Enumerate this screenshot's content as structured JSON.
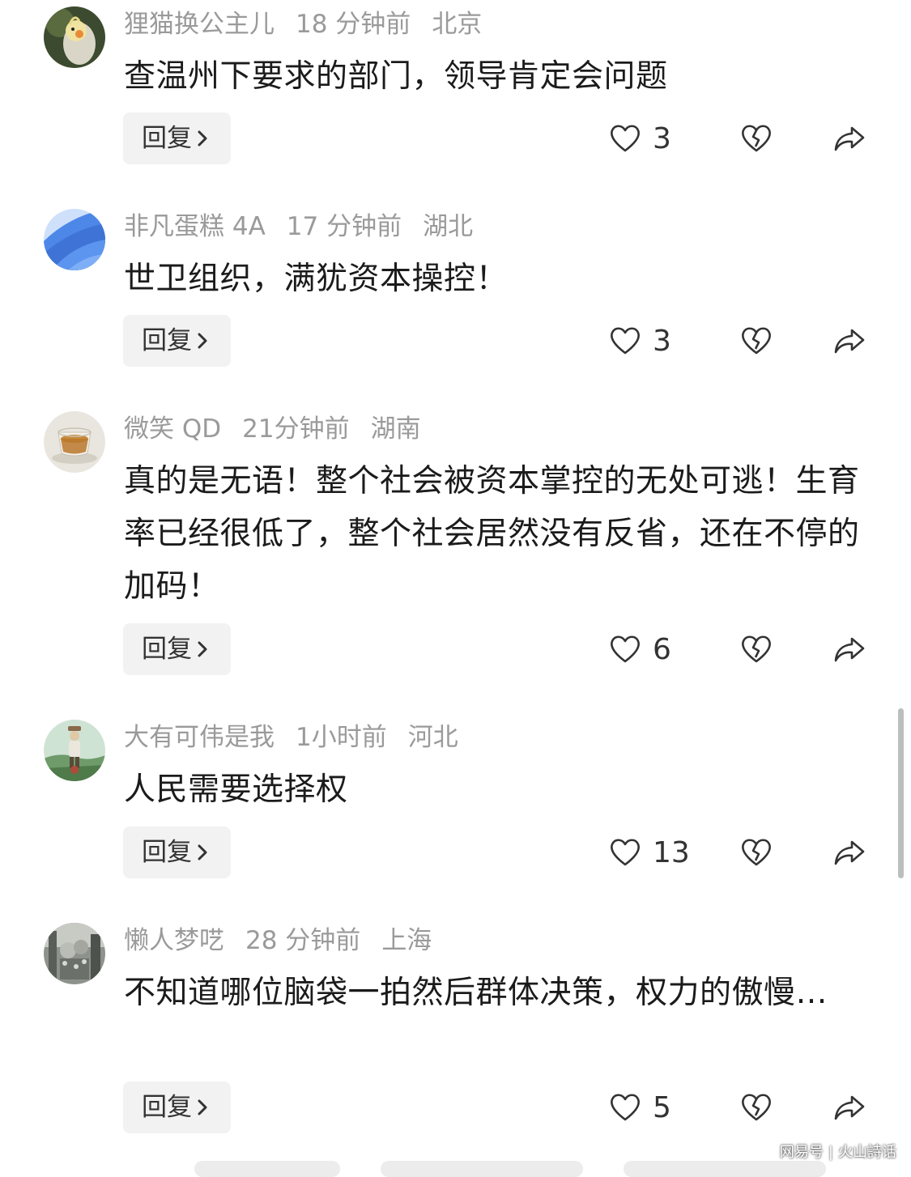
{
  "comments": [
    {
      "username": "狸猫换公主儿",
      "time": "18 分钟前",
      "location": "北京",
      "text": "查温州下要求的部门，领导肯定会问题",
      "reply_label": "回复",
      "likes": "3"
    },
    {
      "username": "非凡蛋糕 4A",
      "time": "17 分钟前",
      "location": "湖北",
      "text": "世卫组织，满犹资本操控！",
      "reply_label": "回复",
      "likes": "3"
    },
    {
      "username": "微笑 QD",
      "time": "21分钟前",
      "location": "湖南",
      "text": "真的是无语！整个社会被资本掌控的无处可逃！生育率已经很低了，整个社会居然没有反省，还在不停的加码！",
      "reply_label": "回复",
      "likes": "6"
    },
    {
      "username": "大有可伟是我",
      "time": "1小时前",
      "location": "河北",
      "text": "人民需要选择权",
      "reply_label": "回复",
      "likes": "13"
    },
    {
      "username": "懒人梦呓",
      "time": "28 分钟前",
      "location": "上海",
      "text": "不知道哪位脑袋一拍然后群体决策，权力的傲慢…",
      "reply_label": "回复",
      "likes": "5"
    }
  ],
  "watermark": {
    "left": "网易号",
    "right": "火山詩话"
  },
  "colors": {
    "meta_text": "#9a9a9a",
    "body_text": "#1b1b1b",
    "reply_bg": "#f2f2f2",
    "icon_stroke": "#333333"
  },
  "icons": {
    "like": "heart-outline-icon",
    "dislike": "broken-heart-icon",
    "share": "share-arrow-icon",
    "reply_chevron": "chevron-right-icon"
  }
}
